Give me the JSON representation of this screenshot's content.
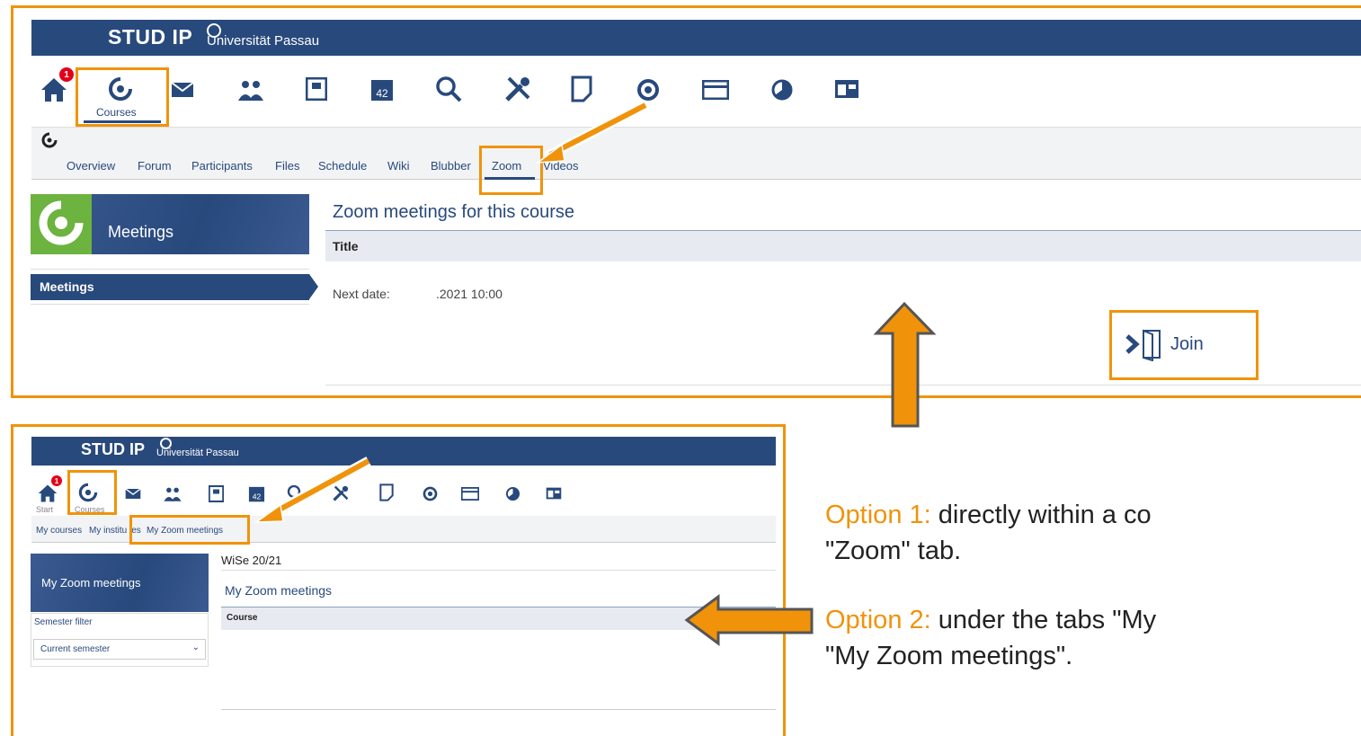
{
  "panel1": {
    "logo": "STUD IP",
    "university": "Universität Passau",
    "badge": "1",
    "nav_courses_label": "Courses",
    "tabs": [
      "Overview",
      "Forum",
      "Participants",
      "Files",
      "Schedule",
      "Wiki",
      "Blubber",
      "Zoom",
      "Videos"
    ],
    "sidebar_title": "Meetings",
    "sidebar_item": "Meetings",
    "content_title": "Zoom meetings for this course",
    "table_header": "Title",
    "next_date_label": "Next date:",
    "next_date_value": ".2021 10:00",
    "join_label": "Join"
  },
  "panel2": {
    "logo": "STUD IP",
    "university": "Universität Passau",
    "badge": "1",
    "nav_start_label": "Start",
    "nav_courses_label": "Courses",
    "tabs": [
      "My courses",
      "My institu",
      "es",
      "My Zoom meetings"
    ],
    "sidebar_title": "My Zoom meetings",
    "filter_label": "Semester filter",
    "filter_value": "Current semester",
    "semester": "WiSe 20/21",
    "content_title": "My Zoom meetings",
    "table_header": "Course"
  },
  "captions": {
    "option1_hl": "Option 1:",
    "option1_text": " directly within a co",
    "option1_line2": "\"Zoom\" tab.",
    "option2_hl": "Option 2:",
    "option2_text": " under the tabs \"My",
    "option2_line2": "\"My Zoom meetings\"."
  },
  "colors": {
    "accent": "#f0930a",
    "brand": "#28497c",
    "badge": "#e2001a"
  }
}
